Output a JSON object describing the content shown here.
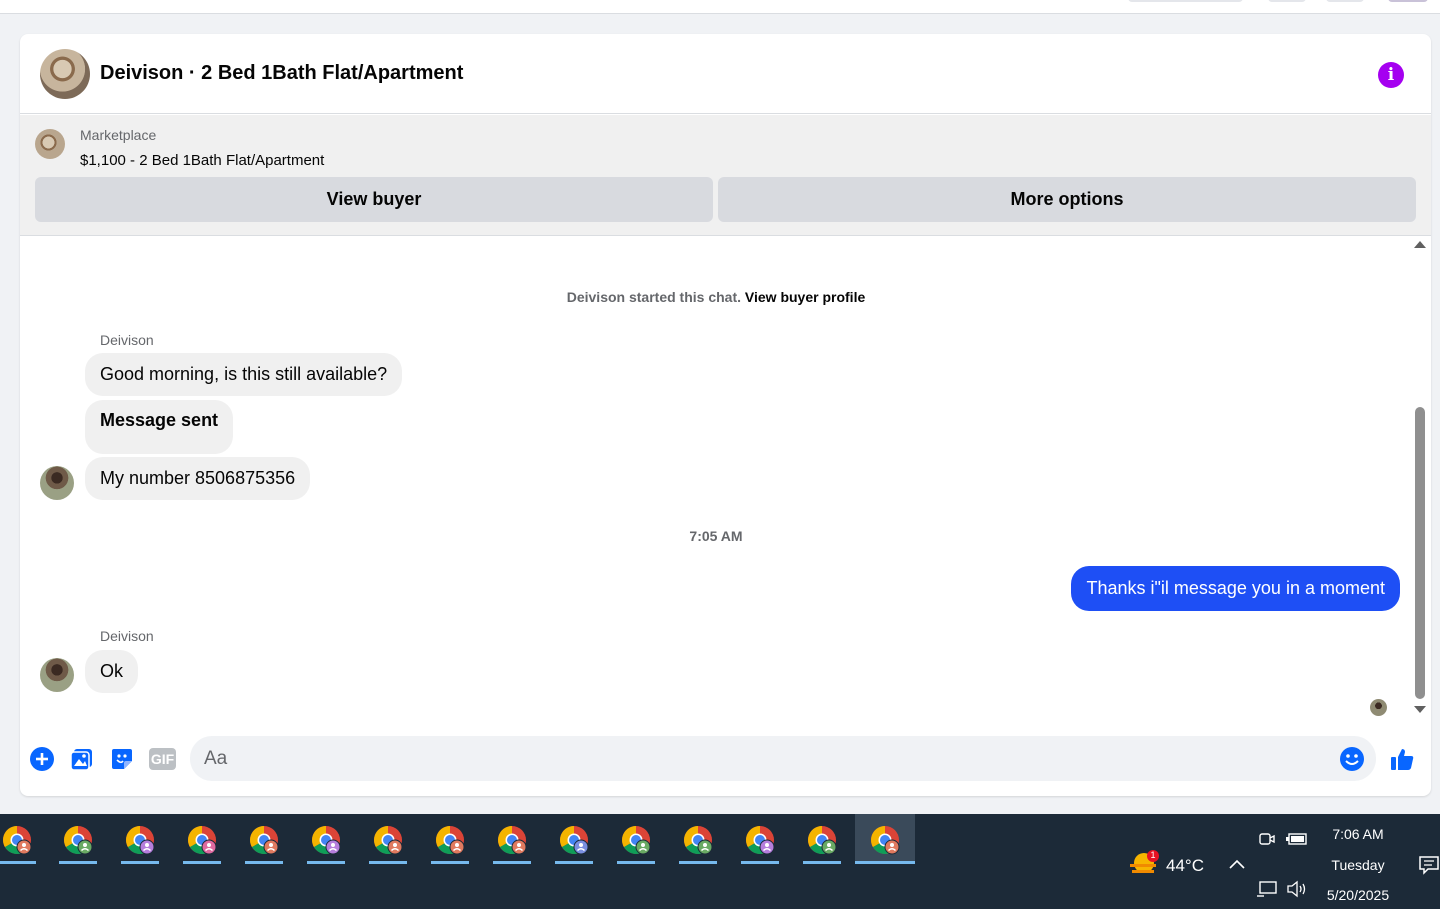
{
  "header": {
    "title": "Deivison · 2 Bed 1Bath Flat/Apartment",
    "info_glyph": "i"
  },
  "marketplace": {
    "label": "Marketplace",
    "listing": "$1,100 - 2 Bed 1Bath Flat/Apartment",
    "view_buyer_label": "View buyer",
    "more_options_label": "More options"
  },
  "thread": {
    "system_text": "Deivison started this chat.",
    "system_link": "View buyer profile",
    "messages": [
      {
        "sender": "Deivison",
        "text": "Good morning, is this still available?"
      },
      {
        "text": "Message sent"
      },
      {
        "text": "My number 8506875356"
      },
      {
        "timestamp": "7:05 AM"
      },
      {
        "text": "Thanks i\"il message you in a moment"
      },
      {
        "sender": "Deivison",
        "text": "Ok"
      }
    ]
  },
  "composer": {
    "placeholder": "Aa",
    "icons": [
      "plus-icon",
      "photo-icon",
      "sticker-icon",
      "gif-icon",
      "emoji-icon",
      "thumbs-up-icon"
    ],
    "gif_text": "GIF"
  },
  "taskbar": {
    "apps_count_label": "chrome",
    "weather_temp": "44°C",
    "weather_badge": "1",
    "time": "7:06 AM",
    "day": "Tuesday",
    "date": "5/20/2025"
  },
  "colors": {
    "accent": "#1e4ff5",
    "info": "#a500f0",
    "like": "#0866ff",
    "taskbar": "#1c2a38"
  }
}
